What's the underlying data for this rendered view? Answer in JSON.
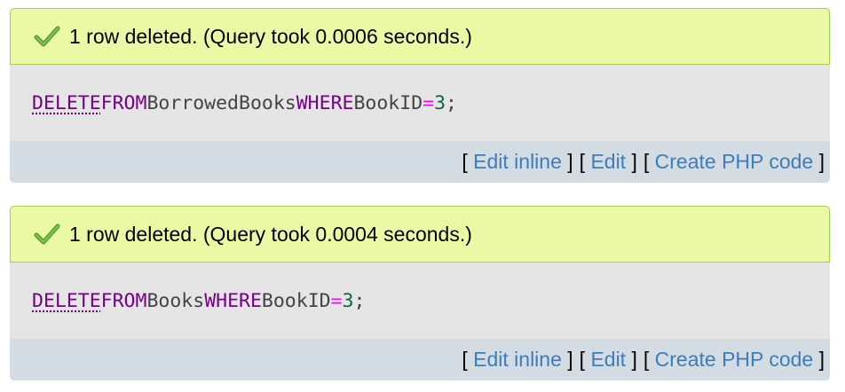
{
  "results": [
    {
      "message": "1 row deleted. (Query took 0.0006 seconds.)",
      "sql": {
        "kw_delete": "DELETE",
        "kw_from": "FROM",
        "table": "BorrowedBooks",
        "kw_where": "WHERE",
        "column": "BookID",
        "operator": "=",
        "value": "3",
        "terminator": ";"
      },
      "links": {
        "edit_inline": "Edit inline",
        "edit": "Edit",
        "create_php": "Create PHP code"
      }
    },
    {
      "message": "1 row deleted. (Query took 0.0004 seconds.)",
      "sql": {
        "kw_delete": "DELETE",
        "kw_from": "FROM",
        "table": "Books",
        "kw_where": "WHERE",
        "column": "BookID",
        "operator": "=",
        "value": "3",
        "terminator": ";"
      },
      "links": {
        "edit_inline": "Edit inline",
        "edit": "Edit",
        "create_php": "Create PHP code"
      }
    }
  ],
  "icons": {
    "success": "check-icon"
  },
  "colors": {
    "success_bg": "#ebf8a4",
    "success_border": "#a2d246",
    "sql_bg": "#e5e5e5",
    "links_bg": "#d3dce3",
    "link": "#3b7dbd",
    "keyword": "#770088",
    "operator": "#ff00ff",
    "number": "#116644"
  }
}
